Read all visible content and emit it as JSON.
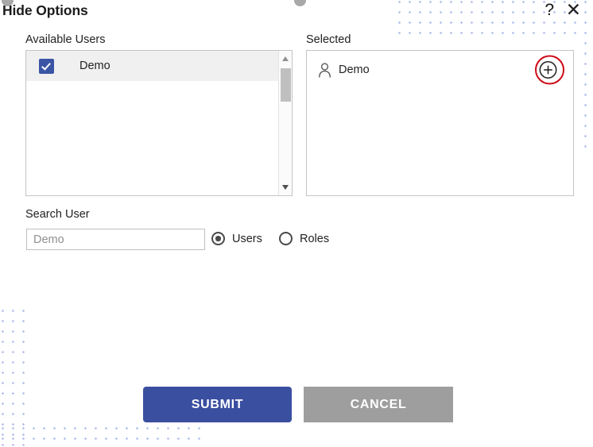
{
  "dialog": {
    "title": "Hide Options",
    "help_icon": "question-mark-help-icon",
    "close_icon": "close-x-icon"
  },
  "available_users": {
    "label": "Available Users",
    "rows": [
      {
        "label": "Demo",
        "checked": true,
        "highlighted": true
      }
    ],
    "scrollbar": {
      "up_arrow": "scroll-up-arrow",
      "down_arrow": "scroll-down-arrow"
    }
  },
  "selected": {
    "label": "Selected",
    "rows": [
      {
        "label": "Demo",
        "icon": "person-icon"
      }
    ],
    "add_button_icon": "circle-plus-icon",
    "annotation_color": "#cf0a17"
  },
  "search": {
    "label": "Search User",
    "value": "",
    "placeholder": "Demo",
    "radios": [
      {
        "label": "Users",
        "checked": true
      },
      {
        "label": "Roles",
        "checked": false
      }
    ]
  },
  "footer": {
    "submit_label": "SUBMIT",
    "cancel_label": "CANCEL",
    "submit_color": "#3b4fa0",
    "cancel_color": "#9e9e9e"
  },
  "decoration": {
    "dot_color": "#a9b8e8"
  }
}
